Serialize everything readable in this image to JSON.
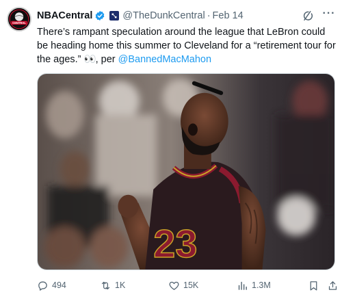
{
  "tweet": {
    "author_name": "NBACentral",
    "handle": "@TheDunkCentral",
    "separator": "·",
    "date": "Feb 14",
    "text_before": "There’s rampant speculation around the league that LeBron could be heading home this summer to Cleveland for a “retirement tour for the ages.” ",
    "emoji": "👀",
    "text_mid": ", per ",
    "mention": "@BannedMacMahon",
    "avatar_label": "CENTRAL",
    "jersey_number": "23",
    "more_glyph": "···"
  },
  "actions": {
    "replies": "494",
    "retweets": "1K",
    "likes": "15K",
    "views": "1.3M"
  },
  "icons": {
    "verified": "verified-badge-icon",
    "affiliate": "affiliate-badge-icon",
    "grok": "grok-icon",
    "more": "more-icon",
    "reply": "reply-icon",
    "retweet": "retweet-icon",
    "like": "heart-icon",
    "views": "views-icon",
    "bookmark": "bookmark-icon",
    "share": "share-icon"
  },
  "colors": {
    "link": "#1d9bf0",
    "verified": "#1d9bf0",
    "muted": "#536471",
    "jersey": "#2a1a1e",
    "jersey_trim": "#8b1a2f",
    "gold": "#c9a227"
  }
}
